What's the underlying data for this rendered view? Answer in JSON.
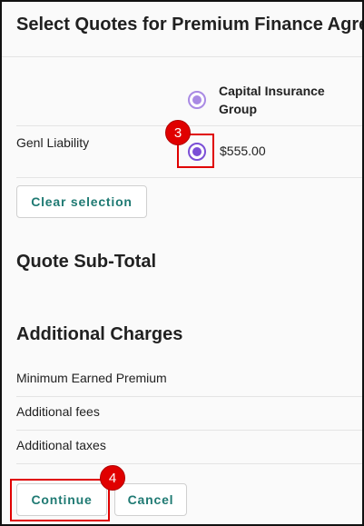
{
  "dialog": {
    "title": "Select Quotes for Premium Finance Agree"
  },
  "quotes": {
    "carrier_name": "Capital Insurance Group",
    "lines": [
      {
        "label": "Genl Liability",
        "price": "$555.00",
        "selected": true
      }
    ],
    "clear_label": "Clear selection"
  },
  "subtotal": {
    "heading": "Quote Sub-Total"
  },
  "charges": {
    "heading": "Additional Charges",
    "rows": [
      "Minimum Earned Premium",
      "Additional fees",
      "Additional taxes"
    ]
  },
  "actions": {
    "continue_label": "Continue",
    "cancel_label": "Cancel"
  },
  "annotations": {
    "step_3": "3",
    "step_4": "4"
  },
  "colors": {
    "accent_purple": "#7b4fd6",
    "button_teal": "#1f7a73",
    "annotation_red": "#e00000"
  }
}
